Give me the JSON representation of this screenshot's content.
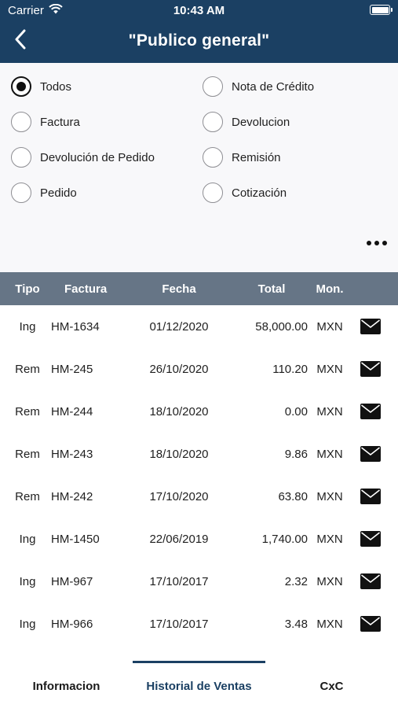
{
  "status_bar": {
    "carrier": "Carrier",
    "time": "10:43 AM"
  },
  "nav": {
    "title": "\"Publico general\""
  },
  "filters": [
    {
      "label": "Todos",
      "checked": true
    },
    {
      "label": "Nota de Crédito",
      "checked": false
    },
    {
      "label": "Factura",
      "checked": false
    },
    {
      "label": "Devolucion",
      "checked": false
    },
    {
      "label": "Devolución de Pedido",
      "checked": false
    },
    {
      "label": "Remisión",
      "checked": false
    },
    {
      "label": "Pedido",
      "checked": false
    },
    {
      "label": "Cotización",
      "checked": false
    }
  ],
  "table": {
    "headers": {
      "tipo": "Tipo",
      "factura": "Factura",
      "fecha": "Fecha",
      "total": "Total",
      "moneda": "Mon."
    },
    "rows": [
      {
        "tipo": "Ing",
        "factura": "HM-1634",
        "fecha": "01/12/2020",
        "total": "58,000.00",
        "moneda": "MXN"
      },
      {
        "tipo": "Rem",
        "factura": "HM-245",
        "fecha": "26/10/2020",
        "total": "110.20",
        "moneda": "MXN"
      },
      {
        "tipo": "Rem",
        "factura": "HM-244",
        "fecha": "18/10/2020",
        "total": "0.00",
        "moneda": "MXN"
      },
      {
        "tipo": "Rem",
        "factura": "HM-243",
        "fecha": "18/10/2020",
        "total": "9.86",
        "moneda": "MXN"
      },
      {
        "tipo": "Rem",
        "factura": "HM-242",
        "fecha": "17/10/2020",
        "total": "63.80",
        "moneda": "MXN"
      },
      {
        "tipo": "Ing",
        "factura": "HM-1450",
        "fecha": "22/06/2019",
        "total": "1,740.00",
        "moneda": "MXN"
      },
      {
        "tipo": "Ing",
        "factura": "HM-967",
        "fecha": "17/10/2017",
        "total": "2.32",
        "moneda": "MXN"
      },
      {
        "tipo": "Ing",
        "factura": "HM-966",
        "fecha": "17/10/2017",
        "total": "3.48",
        "moneda": "MXN"
      }
    ]
  },
  "tabs": [
    {
      "label": "Informacion",
      "active": false
    },
    {
      "label": "Historial de Ventas",
      "active": true
    },
    {
      "label": "CxC",
      "active": false
    }
  ],
  "colors": {
    "nav_bg": "#1b4063",
    "table_header_bg": "#667586",
    "active_tab": "#1b4063"
  },
  "icons": {
    "back": "chevron-left-icon",
    "wifi": "wifi-icon",
    "battery": "battery-icon",
    "more": "more-dots-icon",
    "mail": "mail-icon"
  }
}
